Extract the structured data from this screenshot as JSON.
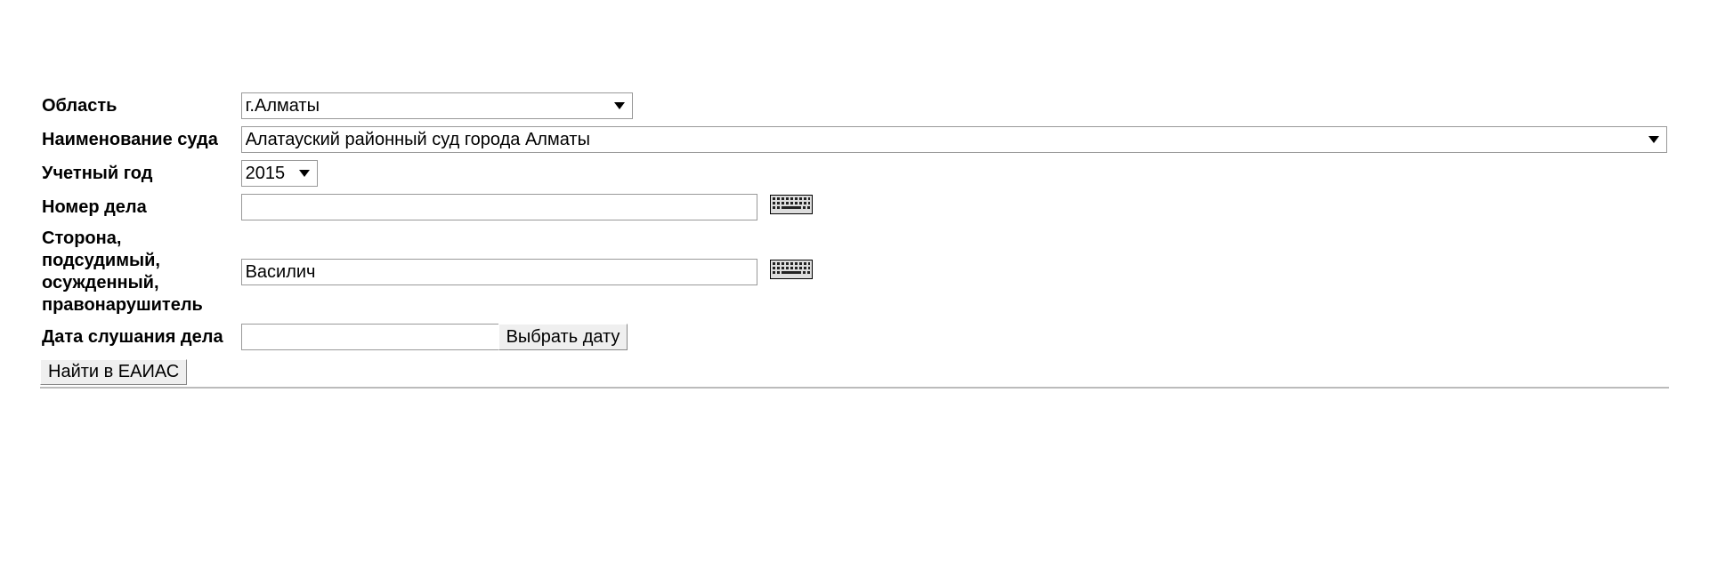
{
  "labels": {
    "region": "Область",
    "court": "Наименование суда",
    "year": "Учетный год",
    "case_number": "Номер дела",
    "party_line1": "Сторона, подсудимый,",
    "party_line2": "осужденный, правонарушитель",
    "hearing_date": "Дата слушания дела"
  },
  "values": {
    "region": "г.Алматы",
    "court": "Алатауский районный суд города Алматы",
    "year": "2015",
    "case_number": "",
    "party": "Василич",
    "hearing_date": ""
  },
  "buttons": {
    "pick_date": "Выбрать дату",
    "submit": "Найти в ЕАИАС"
  }
}
